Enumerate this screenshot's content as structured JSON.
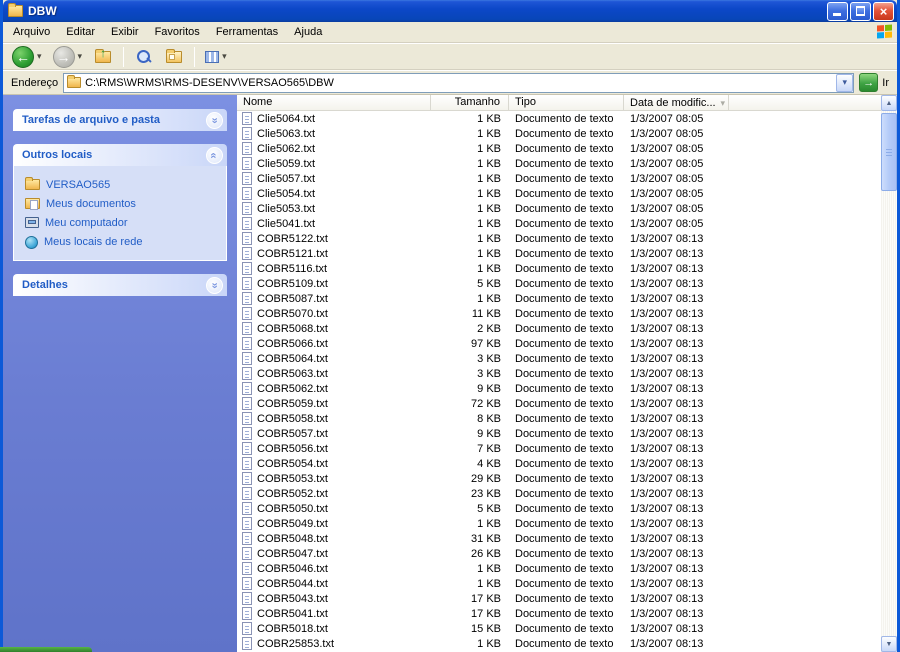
{
  "window": {
    "title": "DBW"
  },
  "menu": {
    "items": [
      "Arquivo",
      "Editar",
      "Exibir",
      "Favoritos",
      "Ferramentas",
      "Ajuda"
    ]
  },
  "address": {
    "label": "Endereço",
    "path": "C:\\RMS\\WRMS\\RMS-DESENV\\VERSAO565\\DBW",
    "go_label": "Ir"
  },
  "icons": {
    "back_arrow": "←",
    "forward_arrow": "→",
    "dropdown": "▾",
    "up_arrow": "↑",
    "chevron_double": "»",
    "close": "×",
    "go_arrow": "→",
    "scroll_up": "▲",
    "scroll_down": "▼",
    "sort": "▾"
  },
  "sidebar": {
    "panels": [
      {
        "title": "Tarefas de arquivo e pasta",
        "collapsed": true
      },
      {
        "title": "Outros locais",
        "collapsed": false,
        "items": [
          {
            "label": "VERSAO565",
            "icon": "folder"
          },
          {
            "label": "Meus documentos",
            "icon": "documents"
          },
          {
            "label": "Meu computador",
            "icon": "computer"
          },
          {
            "label": "Meus locais de rede",
            "icon": "network"
          }
        ]
      },
      {
        "title": "Detalhes",
        "collapsed": true
      }
    ]
  },
  "filelist": {
    "columns": [
      "Nome",
      "Tamanho",
      "Tipo",
      "Data de modific..."
    ],
    "rows": [
      [
        "Clie5064.txt",
        "1 KB",
        "Documento de texto",
        "1/3/2007 08:05"
      ],
      [
        "Clie5063.txt",
        "1 KB",
        "Documento de texto",
        "1/3/2007 08:05"
      ],
      [
        "Clie5062.txt",
        "1 KB",
        "Documento de texto",
        "1/3/2007 08:05"
      ],
      [
        "Clie5059.txt",
        "1 KB",
        "Documento de texto",
        "1/3/2007 08:05"
      ],
      [
        "Clie5057.txt",
        "1 KB",
        "Documento de texto",
        "1/3/2007 08:05"
      ],
      [
        "Clie5054.txt",
        "1 KB",
        "Documento de texto",
        "1/3/2007 08:05"
      ],
      [
        "Clie5053.txt",
        "1 KB",
        "Documento de texto",
        "1/3/2007 08:05"
      ],
      [
        "Clie5041.txt",
        "1 KB",
        "Documento de texto",
        "1/3/2007 08:05"
      ],
      [
        "COBR5122.txt",
        "1 KB",
        "Documento de texto",
        "1/3/2007 08:13"
      ],
      [
        "COBR5121.txt",
        "1 KB",
        "Documento de texto",
        "1/3/2007 08:13"
      ],
      [
        "COBR5116.txt",
        "1 KB",
        "Documento de texto",
        "1/3/2007 08:13"
      ],
      [
        "COBR5109.txt",
        "5 KB",
        "Documento de texto",
        "1/3/2007 08:13"
      ],
      [
        "COBR5087.txt",
        "1 KB",
        "Documento de texto",
        "1/3/2007 08:13"
      ],
      [
        "COBR5070.txt",
        "11 KB",
        "Documento de texto",
        "1/3/2007 08:13"
      ],
      [
        "COBR5068.txt",
        "2 KB",
        "Documento de texto",
        "1/3/2007 08:13"
      ],
      [
        "COBR5066.txt",
        "97 KB",
        "Documento de texto",
        "1/3/2007 08:13"
      ],
      [
        "COBR5064.txt",
        "3 KB",
        "Documento de texto",
        "1/3/2007 08:13"
      ],
      [
        "COBR5063.txt",
        "3 KB",
        "Documento de texto",
        "1/3/2007 08:13"
      ],
      [
        "COBR5062.txt",
        "9 KB",
        "Documento de texto",
        "1/3/2007 08:13"
      ],
      [
        "COBR5059.txt",
        "72 KB",
        "Documento de texto",
        "1/3/2007 08:13"
      ],
      [
        "COBR5058.txt",
        "8 KB",
        "Documento de texto",
        "1/3/2007 08:13"
      ],
      [
        "COBR5057.txt",
        "9 KB",
        "Documento de texto",
        "1/3/2007 08:13"
      ],
      [
        "COBR5056.txt",
        "7 KB",
        "Documento de texto",
        "1/3/2007 08:13"
      ],
      [
        "COBR5054.txt",
        "4 KB",
        "Documento de texto",
        "1/3/2007 08:13"
      ],
      [
        "COBR5053.txt",
        "29 KB",
        "Documento de texto",
        "1/3/2007 08:13"
      ],
      [
        "COBR5052.txt",
        "23 KB",
        "Documento de texto",
        "1/3/2007 08:13"
      ],
      [
        "COBR5050.txt",
        "5 KB",
        "Documento de texto",
        "1/3/2007 08:13"
      ],
      [
        "COBR5049.txt",
        "1 KB",
        "Documento de texto",
        "1/3/2007 08:13"
      ],
      [
        "COBR5048.txt",
        "31 KB",
        "Documento de texto",
        "1/3/2007 08:13"
      ],
      [
        "COBR5047.txt",
        "26 KB",
        "Documento de texto",
        "1/3/2007 08:13"
      ],
      [
        "COBR5046.txt",
        "1 KB",
        "Documento de texto",
        "1/3/2007 08:13"
      ],
      [
        "COBR5044.txt",
        "1 KB",
        "Documento de texto",
        "1/3/2007 08:13"
      ],
      [
        "COBR5043.txt",
        "17 KB",
        "Documento de texto",
        "1/3/2007 08:13"
      ],
      [
        "COBR5041.txt",
        "17 KB",
        "Documento de texto",
        "1/3/2007 08:13"
      ],
      [
        "COBR5018.txt",
        "15 KB",
        "Documento de texto",
        "1/3/2007 08:13"
      ],
      [
        "COBR25853.txt",
        "1 KB",
        "Documento de texto",
        "1/3/2007 08:13"
      ]
    ]
  }
}
